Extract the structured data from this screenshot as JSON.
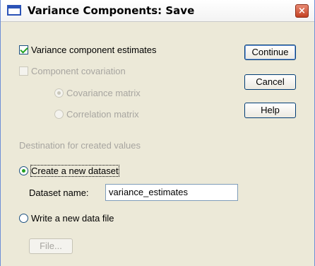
{
  "window": {
    "title": "Variance Components: Save",
    "close_label": "×"
  },
  "options": {
    "variance_estimates": {
      "label": "Variance component estimates",
      "checked": true
    },
    "component_covariation": {
      "label": "Component covariation",
      "checked": false,
      "enabled": false
    },
    "covariance_matrix": {
      "label": "Covariance matrix",
      "selected": true,
      "enabled": false
    },
    "correlation_matrix": {
      "label": "Correlation matrix",
      "selected": false,
      "enabled": false
    }
  },
  "buttons": {
    "continue": "Continue",
    "cancel": "Cancel",
    "help": "Help",
    "file": "File..."
  },
  "destination": {
    "group_label": "Destination for created values",
    "create_dataset": {
      "label": "Create a new dataset",
      "selected": true
    },
    "dataset_name_label": "Dataset name:",
    "dataset_name_value": "variance_estimates",
    "write_file": {
      "label": "Write a new data file",
      "selected": false
    }
  },
  "colors": {
    "dialog_bg": "#ece9d8",
    "check_green": "#21a121",
    "disabled_text": "#a7a5a0",
    "close_red": "#c34122"
  }
}
